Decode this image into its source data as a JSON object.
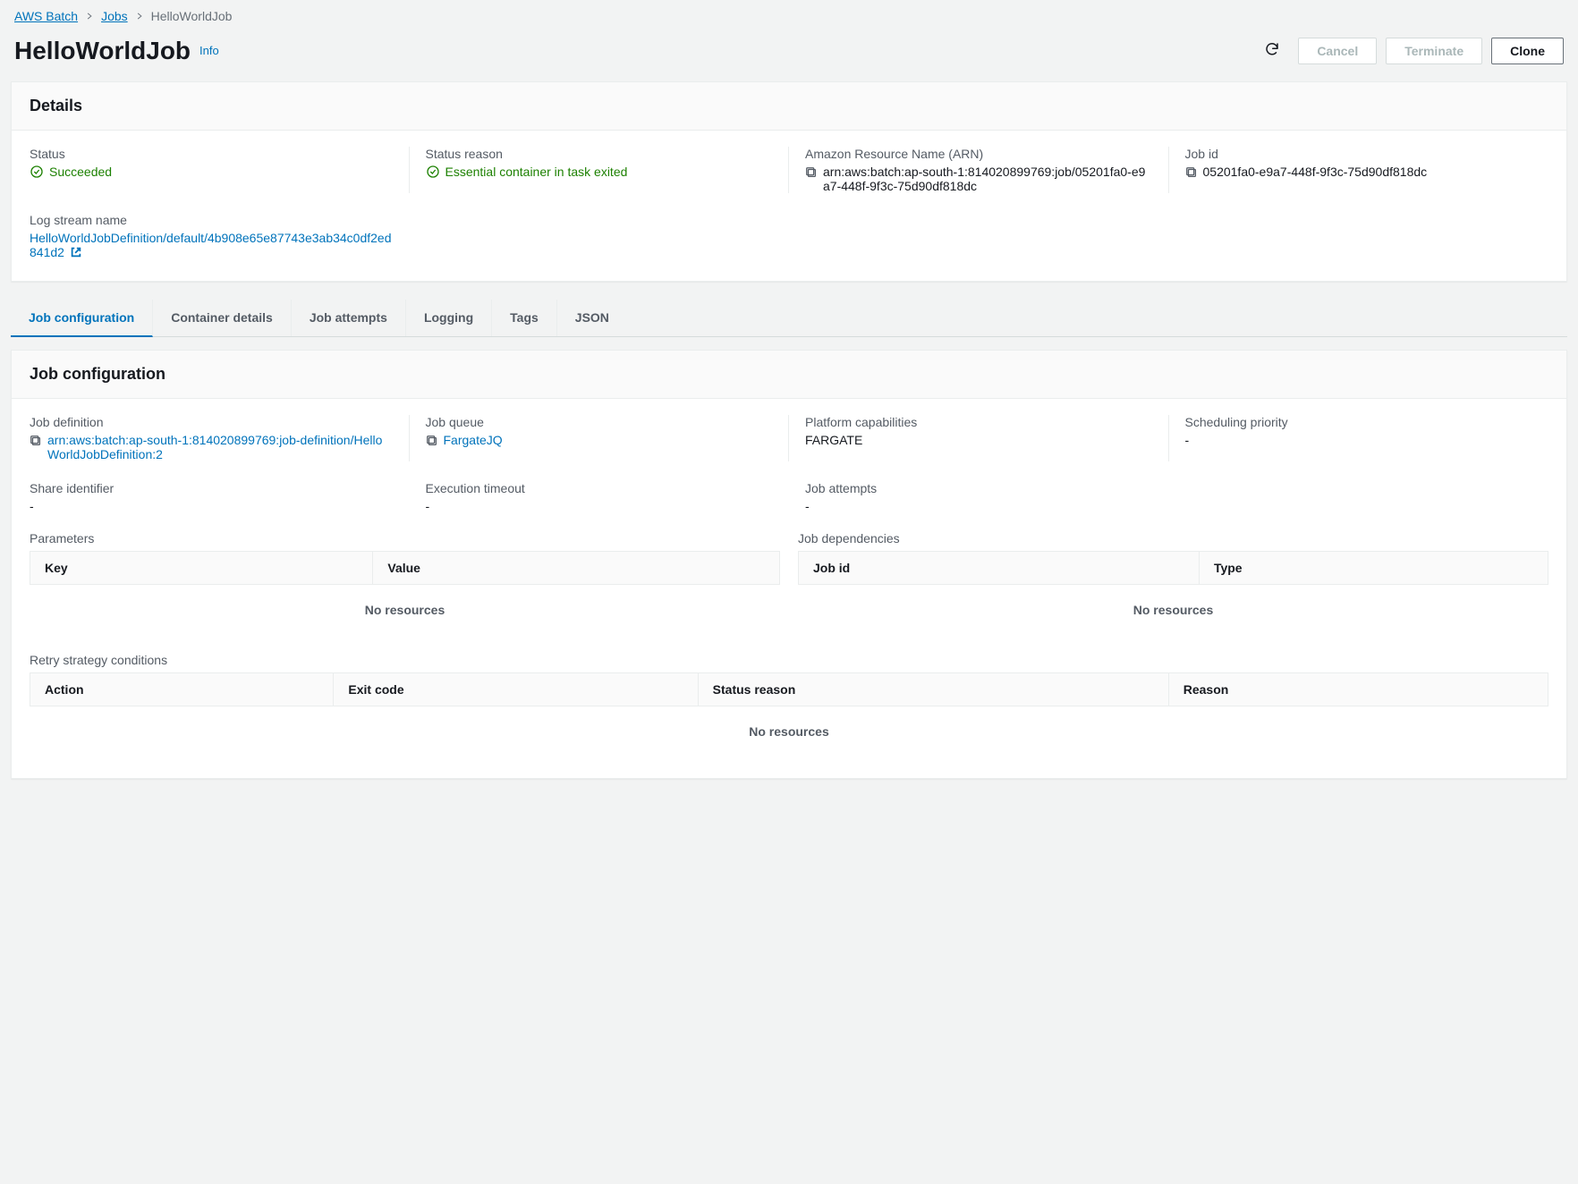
{
  "breadcrumb": {
    "root": "AWS Batch",
    "parent": "Jobs",
    "current": "HelloWorldJob"
  },
  "header": {
    "title": "HelloWorldJob",
    "info": "Info",
    "cancel": "Cancel",
    "terminate": "Terminate",
    "clone": "Clone"
  },
  "details": {
    "panel_title": "Details",
    "status_label": "Status",
    "status_value": "Succeeded",
    "status_reason_label": "Status reason",
    "status_reason_value": "Essential container in task exited",
    "arn_label": "Amazon Resource Name (ARN)",
    "arn_value": "arn:aws:batch:ap-south-1:814020899769:job/05201fa0-e9a7-448f-9f3c-75d90df818dc",
    "job_id_label": "Job id",
    "job_id_value": "05201fa0-e9a7-448f-9f3c-75d90df818dc",
    "log_stream_label": "Log stream name",
    "log_stream_value": "HelloWorldJobDefinition/default/4b908e65e87743e3ab34c0df2ed841d2"
  },
  "tabs": {
    "job_configuration": "Job configuration",
    "container_details": "Container details",
    "job_attempts": "Job attempts",
    "logging": "Logging",
    "tags": "Tags",
    "json": "JSON"
  },
  "jobconfig": {
    "panel_title": "Job configuration",
    "job_definition_label": "Job definition",
    "job_definition_value": "arn:aws:batch:ap-south-1:814020899769:job-definition/HelloWorldJobDefinition:2",
    "job_queue_label": "Job queue",
    "job_queue_value": "FargateJQ",
    "platform_label": "Platform capabilities",
    "platform_value": "FARGATE",
    "priority_label": "Scheduling priority",
    "priority_value": "-",
    "share_label": "Share identifier",
    "share_value": "-",
    "timeout_label": "Execution timeout",
    "timeout_value": "-",
    "attempts_label": "Job attempts",
    "attempts_value": "-",
    "parameters_label": "Parameters",
    "dependencies_label": "Job dependencies",
    "params_key_col": "Key",
    "params_value_col": "Value",
    "deps_jobid_col": "Job id",
    "deps_type_col": "Type",
    "retry_label": "Retry strategy conditions",
    "retry_action_col": "Action",
    "retry_exit_col": "Exit code",
    "retry_reason_col": "Status reason",
    "retry_reason2_col": "Reason",
    "no_resources": "No resources"
  }
}
